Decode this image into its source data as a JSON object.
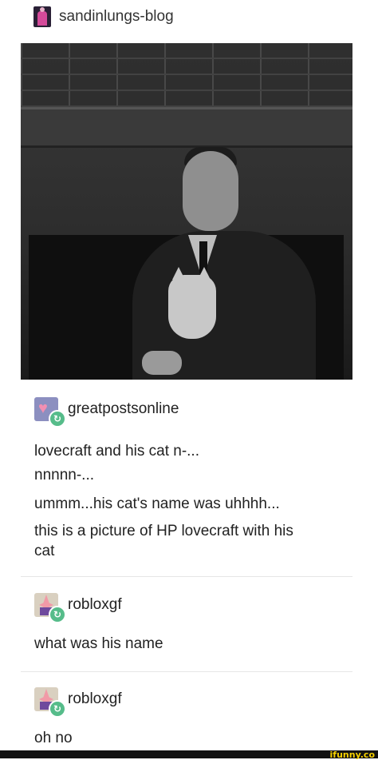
{
  "header": {
    "username": "sandinlungs-blog",
    "avatar_icon": "user-avatar-icon"
  },
  "posts": [
    {
      "username": "greatpostsonline",
      "lines": [
        "lovecraft and his cat n-...",
        "nnnnn-...",
        "ummm...his cat's name was uhhhh...",
        "this is a picture of HP lovecraft with his",
        "cat"
      ]
    },
    {
      "username": "robloxgf",
      "lines": [
        "what was his name"
      ]
    },
    {
      "username": "robloxgf",
      "lines": [
        "oh no"
      ]
    }
  ],
  "reblog_icon": "↻",
  "watermark": "ifunny.co"
}
